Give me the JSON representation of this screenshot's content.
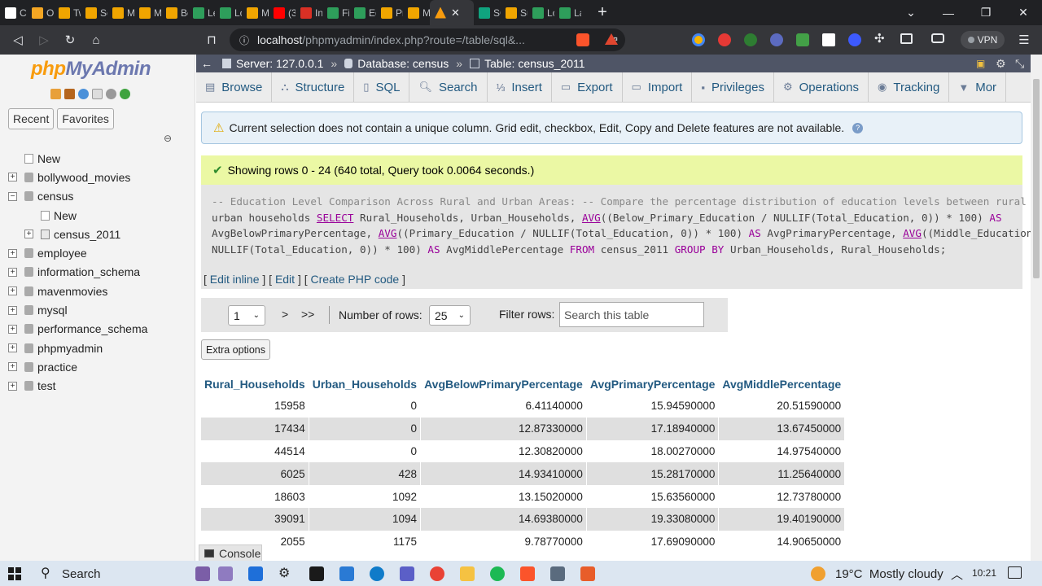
{
  "browser": {
    "tabs": [
      {
        "label": "Cu",
        "color": "#ffffff"
      },
      {
        "label": "Ol",
        "color": "#f5a623"
      },
      {
        "label": "Tw",
        "color": "#f0a500"
      },
      {
        "label": "Sc",
        "color": "#f0a500"
      },
      {
        "label": "M",
        "color": "#f0a500"
      },
      {
        "label": "M",
        "color": "#f0a500"
      },
      {
        "label": "Be",
        "color": "#f0a500"
      },
      {
        "label": "Le",
        "color": "#2e9e5b"
      },
      {
        "label": "Lo",
        "color": "#2e9e5b"
      },
      {
        "label": "M",
        "color": "#f0a500"
      },
      {
        "label": "(3",
        "color": "#ff0000"
      },
      {
        "label": "Ini",
        "color": "#d93025"
      },
      {
        "label": "Fir",
        "color": "#2e9e5b"
      },
      {
        "label": "Eq",
        "color": "#2e9e5b"
      },
      {
        "label": "Pr",
        "color": "#f0a500"
      },
      {
        "label": "M",
        "color": "#f0a500"
      }
    ],
    "active_tab": {
      "label": "",
      "close": "✕"
    },
    "tabs_after": [
      {
        "label": "SC",
        "color": "#10a37f"
      },
      {
        "label": "Su",
        "color": "#f0a500"
      },
      {
        "label": "Lo",
        "color": "#2e9e5b"
      },
      {
        "label": "La",
        "color": "#2e9e5b"
      }
    ],
    "url_host": "localhost",
    "url_path": "/phpmyadmin/index.php?route=/table/sql&...",
    "vpn_label": "VPN"
  },
  "pma": {
    "logo_php": "php",
    "logo_my": "MyAdmin",
    "recent_label": "Recent",
    "favorites_label": "Favorites",
    "tree": [
      {
        "label": "New",
        "level": 0,
        "type": "new"
      },
      {
        "label": "bollywood_movies",
        "level": 0,
        "type": "db",
        "toggle": "+"
      },
      {
        "label": "census",
        "level": 0,
        "type": "db",
        "toggle": "−"
      },
      {
        "label": "New",
        "level": 1,
        "type": "new"
      },
      {
        "label": "census_2011",
        "level": 1,
        "type": "table",
        "toggle": "+"
      },
      {
        "label": "employee",
        "level": 0,
        "type": "db",
        "toggle": "+"
      },
      {
        "label": "information_schema",
        "level": 0,
        "type": "db",
        "toggle": "+"
      },
      {
        "label": "mavenmovies",
        "level": 0,
        "type": "db",
        "toggle": "+"
      },
      {
        "label": "mysql",
        "level": 0,
        "type": "db",
        "toggle": "+"
      },
      {
        "label": "performance_schema",
        "level": 0,
        "type": "db",
        "toggle": "+"
      },
      {
        "label": "phpmyadmin",
        "level": 0,
        "type": "db",
        "toggle": "+"
      },
      {
        "label": "practice",
        "level": 0,
        "type": "db",
        "toggle": "+"
      },
      {
        "label": "test",
        "level": 0,
        "type": "db",
        "toggle": "+"
      }
    ],
    "breadcrumb": {
      "server": "Server: 127.0.0.1",
      "database": "Database: census",
      "table": "Table: census_2011"
    },
    "menu": [
      {
        "label": "Browse",
        "icon": "▤"
      },
      {
        "label": "Structure",
        "icon": "⛬"
      },
      {
        "label": "SQL",
        "icon": "▯"
      },
      {
        "label": "Search",
        "icon": "🔍︎"
      },
      {
        "label": "Insert",
        "icon": "⅓"
      },
      {
        "label": "Export",
        "icon": "▭"
      },
      {
        "label": "Import",
        "icon": "▭"
      },
      {
        "label": "Privileges",
        "icon": "▪"
      },
      {
        "label": "Operations",
        "icon": "⚙"
      },
      {
        "label": "Tracking",
        "icon": "◉"
      },
      {
        "label": "Mor",
        "icon": "▼"
      }
    ],
    "notice": "Current selection does not contain a unique column. Grid edit, checkbox, Edit, Copy and Delete features are not available.",
    "success": "Showing rows 0 - 24 (640 total, Query took 0.0064 seconds.)",
    "sql_lines": [
      "-- Education Level Comparison Across Rural and Urban Areas: -- Compare the percentage distribution of education levels between rural and",
      "urban households SELECT Rural_Households, Urban_Households, AVG((Below_Primary_Education / NULLIF(Total_Education, 0)) * 100) AS",
      "AvgBelowPrimaryPercentage, AVG((Primary_Education / NULLIF(Total_Education, 0)) * 100) AS AvgPrimaryPercentage, AVG((Middle_Education /",
      "NULLIF(Total_Education, 0)) * 100) AS AvgMiddlePercentage FROM census_2011 GROUP BY Urban_Households, Rural_Households;"
    ],
    "sql_links": {
      "edit_inline": "Edit inline",
      "edit": "Edit",
      "create_php": "Create PHP code"
    },
    "nav": {
      "page_value": "1",
      "next": ">",
      "last": ">>",
      "rows_label": "Number of rows:",
      "rows_value": "25",
      "filter_label": "Filter rows:",
      "filter_placeholder": "Search this table"
    },
    "extra_options": "Extra options",
    "columns": [
      "Rural_Households",
      "Urban_Households",
      "AvgBelowPrimaryPercentage",
      "AvgPrimaryPercentage",
      "AvgMiddlePercentage"
    ],
    "rows": [
      [
        "15958",
        "0",
        "6.41140000",
        "15.94590000",
        "20.51590000"
      ],
      [
        "17434",
        "0",
        "12.87330000",
        "17.18940000",
        "13.67450000"
      ],
      [
        "44514",
        "0",
        "12.30820000",
        "18.00270000",
        "14.97540000"
      ],
      [
        "6025",
        "428",
        "14.93410000",
        "15.28170000",
        "11.25640000"
      ],
      [
        "18603",
        "1092",
        "13.15020000",
        "15.63560000",
        "12.73780000"
      ],
      [
        "39091",
        "1094",
        "14.69380000",
        "19.33080000",
        "19.40190000"
      ],
      [
        "2055",
        "1175",
        "9.78770000",
        "17.69090000",
        "14.90650000"
      ]
    ],
    "console_label": "Console"
  },
  "taskbar": {
    "search_label": "Search",
    "weather": "19°C  Mostly cloudy",
    "time": "10:21"
  }
}
